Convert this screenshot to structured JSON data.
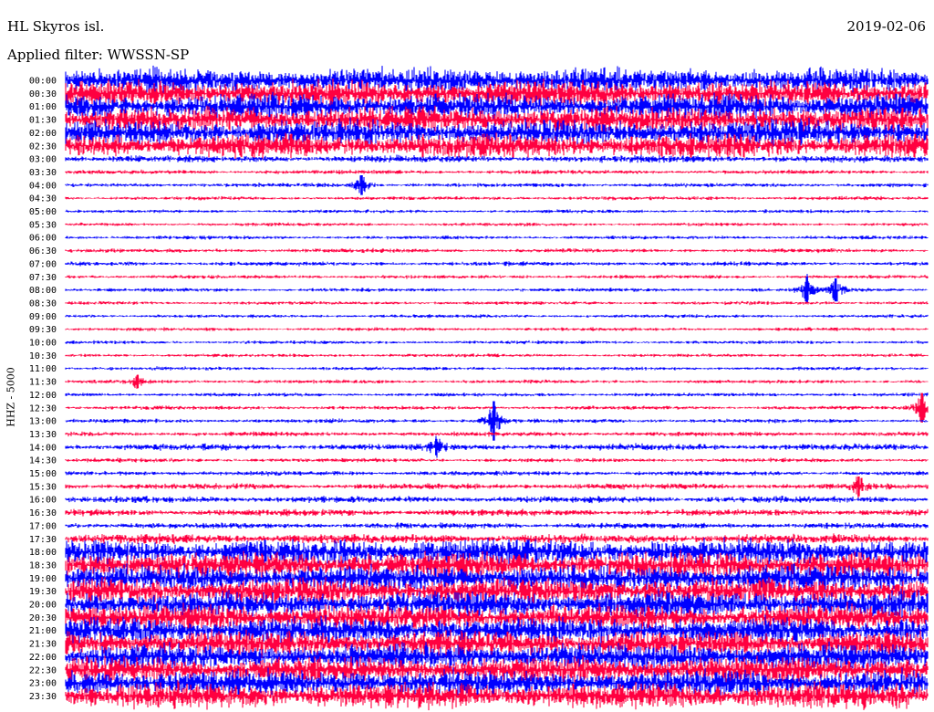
{
  "header": {
    "station": "HL Skyros isl.",
    "date": "2019-02-06",
    "filter": "Applied filter: WWSSN-SP",
    "channel": "HHZ - 5000"
  },
  "colors": {
    "even_trace": "#0000ff",
    "odd_trace": "#ff0040",
    "background": "#ffffff"
  },
  "chart_data": {
    "type": "line",
    "title": "HL Skyros isl.",
    "subtitle": "Applied filter: WWSSN-SP",
    "date": "2019-02-06",
    "ylabel": "HHZ - 5000",
    "trace_interval_minutes": 30,
    "color_cycle": [
      "#0000ff",
      "#ff0040"
    ],
    "rows": [
      {
        "label": "00:00",
        "noise": 1.0
      },
      {
        "label": "00:30",
        "noise": 1.0
      },
      {
        "label": "01:00",
        "noise": 1.0
      },
      {
        "label": "01:30",
        "noise": 1.0
      },
      {
        "label": "02:00",
        "noise": 1.0
      },
      {
        "label": "02:30",
        "noise": 0.9
      },
      {
        "label": "03:00",
        "noise": 0.2
      },
      {
        "label": "03:30",
        "noise": 0.08
      },
      {
        "label": "04:00",
        "noise": 0.08
      },
      {
        "label": "04:30",
        "noise": 0.06
      },
      {
        "label": "05:00",
        "noise": 0.05
      },
      {
        "label": "05:30",
        "noise": 0.05
      },
      {
        "label": "06:00",
        "noise": 0.06
      },
      {
        "label": "06:30",
        "noise": 0.08
      },
      {
        "label": "07:00",
        "noise": 0.08
      },
      {
        "label": "07:30",
        "noise": 0.06
      },
      {
        "label": "08:00",
        "noise": 0.06
      },
      {
        "label": "08:30",
        "noise": 0.05
      },
      {
        "label": "09:00",
        "noise": 0.05
      },
      {
        "label": "09:30",
        "noise": 0.05
      },
      {
        "label": "10:00",
        "noise": 0.05
      },
      {
        "label": "10:30",
        "noise": 0.05
      },
      {
        "label": "11:00",
        "noise": 0.06
      },
      {
        "label": "11:30",
        "noise": 0.06
      },
      {
        "label": "12:00",
        "noise": 0.06
      },
      {
        "label": "12:30",
        "noise": 0.07
      },
      {
        "label": "13:00",
        "noise": 0.08
      },
      {
        "label": "13:30",
        "noise": 0.1
      },
      {
        "label": "14:00",
        "noise": 0.18
      },
      {
        "label": "14:30",
        "noise": 0.08
      },
      {
        "label": "15:00",
        "noise": 0.1
      },
      {
        "label": "15:30",
        "noise": 0.15
      },
      {
        "label": "16:00",
        "noise": 0.18
      },
      {
        "label": "16:30",
        "noise": 0.18
      },
      {
        "label": "17:00",
        "noise": 0.15
      },
      {
        "label": "17:30",
        "noise": 0.3
      },
      {
        "label": "18:00",
        "noise": 1.0
      },
      {
        "label": "18:30",
        "noise": 1.0
      },
      {
        "label": "19:00",
        "noise": 1.0
      },
      {
        "label": "19:30",
        "noise": 1.0
      },
      {
        "label": "20:00",
        "noise": 1.0
      },
      {
        "label": "20:30",
        "noise": 1.0
      },
      {
        "label": "21:00",
        "noise": 1.0
      },
      {
        "label": "21:30",
        "noise": 1.0
      },
      {
        "label": "22:00",
        "noise": 1.0
      },
      {
        "label": "22:30",
        "noise": 1.0
      },
      {
        "label": "23:00",
        "noise": 1.0
      },
      {
        "label": "23:30",
        "noise": 1.0
      }
    ],
    "events": [
      {
        "row": "04:00",
        "minute": 10.3,
        "amplitude": 0.6
      },
      {
        "row": "08:00",
        "minute": 25.8,
        "amplitude": 0.8
      },
      {
        "row": "08:00",
        "minute": 26.8,
        "amplitude": 0.7
      },
      {
        "row": "11:30",
        "minute": 2.5,
        "amplitude": 0.4
      },
      {
        "row": "12:30",
        "minute": 29.8,
        "amplitude": 0.9
      },
      {
        "row": "13:00",
        "minute": 14.9,
        "amplitude": 1.2
      },
      {
        "row": "14:00",
        "minute": 12.9,
        "amplitude": 0.5
      },
      {
        "row": "15:30",
        "minute": 27.6,
        "amplitude": 0.6
      }
    ]
  }
}
